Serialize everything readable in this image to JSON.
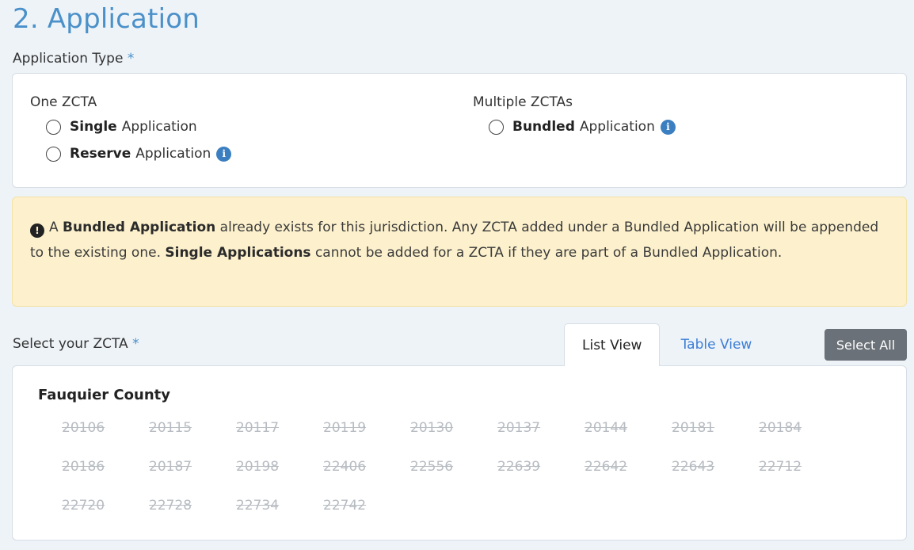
{
  "section": {
    "title": "2. Application"
  },
  "application_type": {
    "label": "Application Type",
    "required_mark": "*",
    "groups": [
      {
        "title": "One ZCTA",
        "options": [
          {
            "bold": "Single",
            "rest": "Application",
            "info": false
          },
          {
            "bold": "Reserve",
            "rest": "Application",
            "info": true
          }
        ]
      },
      {
        "title": "Multiple ZCTAs",
        "options": [
          {
            "bold": "Bundled",
            "rest": "Application",
            "info": true
          }
        ]
      }
    ]
  },
  "alert": {
    "icon": "exclamation-circle-icon",
    "part1": "A ",
    "bold1": "Bundled Application",
    "part2": " already exists for this jurisdiction. Any ZCTA added under a Bundled Application will be appended to the existing one. ",
    "bold2": "Single Applications",
    "part3": " cannot be added for a ZCTA if they are part of a Bundled Application.",
    "colors": {
      "background": "#fdf1cd",
      "border": "#f3e1a3"
    }
  },
  "zcta_select": {
    "label": "Select your ZCTA",
    "required_mark": "*",
    "tabs": {
      "list": "List View",
      "table": "Table View"
    },
    "select_all": "Select All"
  },
  "county": {
    "name": "Fauquier County",
    "zctas": [
      "20106",
      "20115",
      "20117",
      "20119",
      "20130",
      "20137",
      "20144",
      "20181",
      "20184",
      "20186",
      "20187",
      "20198",
      "22406",
      "22556",
      "22639",
      "22642",
      "22643",
      "22712",
      "22720",
      "22728",
      "22734",
      "22742"
    ]
  },
  "colors": {
    "accent": "#4a90c9",
    "link": "#3a7ed6",
    "info": "#3c7fc1",
    "disabled_text": "#b7bcc2"
  }
}
